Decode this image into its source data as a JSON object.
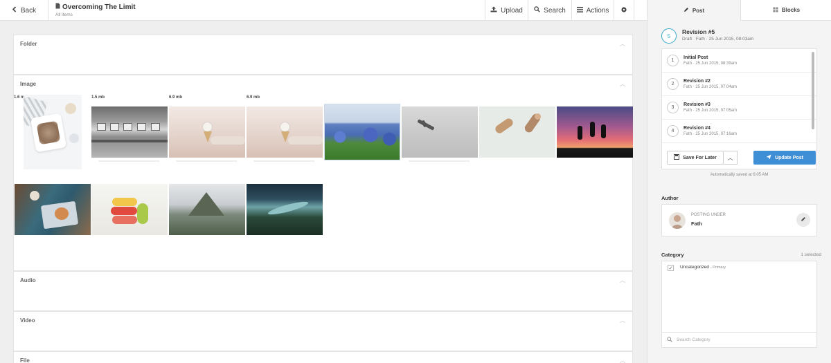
{
  "topbar": {
    "back_label": "Back",
    "title": "Overcoming The Limit",
    "subtitle": "All Items",
    "upload_label": "Upload",
    "search_label": "Search",
    "actions_label": "Actions"
  },
  "sections": {
    "folder": "Folder",
    "image": "Image",
    "audio": "Audio",
    "video": "Video",
    "file": "File"
  },
  "images": [
    {
      "size": "1.6 mb",
      "subject": "Rice bowl flatlay"
    },
    {
      "size": "1.5 mb",
      "subject": "Subway interior"
    },
    {
      "size": "6.9 mb",
      "subject": "Ice cream cone"
    },
    {
      "size": "6.9 mb",
      "subject": "Ice cream cone"
    },
    {
      "size": "",
      "subject": "Bluebonnet field"
    },
    {
      "size": "",
      "subject": "Bird in fog"
    },
    {
      "size": "",
      "subject": "Jumping cats"
    },
    {
      "size": "",
      "subject": "Sunset silhouettes"
    },
    {
      "size": "",
      "subject": "Cafe table"
    },
    {
      "size": "",
      "subject": "Macarons"
    },
    {
      "size": "",
      "subject": "Misty mountain"
    },
    {
      "size": "",
      "subject": "Lake aerial"
    }
  ],
  "sidebar": {
    "tab_post": "Post",
    "tab_blocks": "Blocks",
    "current_revision": {
      "num": "5",
      "name": "Revision #5",
      "meta": "Draft · Fath · 25 Jun 2015, 08:03am"
    },
    "revisions": [
      {
        "num": "1",
        "name": "Initial Post",
        "meta": "Fath · 25 Jun 2015, 08:39am"
      },
      {
        "num": "2",
        "name": "Revision #2",
        "meta": "Fath · 25 Jun 2015, 07:04am"
      },
      {
        "num": "3",
        "name": "Revision #3",
        "meta": "Fath · 25 Jun 2015, 07:05am"
      },
      {
        "num": "4",
        "name": "Revision #4",
        "meta": "Fath · 25 Jun 2015, 07:16am"
      }
    ],
    "save_label": "Save For Later",
    "update_label": "Update Post",
    "autosave_text": "Automatically saved at 6:05 AM",
    "author_label": "Author",
    "posting_under": "POSTING UNDER",
    "author_name": "Fath",
    "category_label": "Category",
    "category_count": "1 selected",
    "category_item": "Uncategorized",
    "category_tag": "- Primary",
    "category_search_placeholder": "Search Category"
  },
  "colors": {
    "accent": "#3f8fd6",
    "revision_ring": "#37a8c8"
  }
}
